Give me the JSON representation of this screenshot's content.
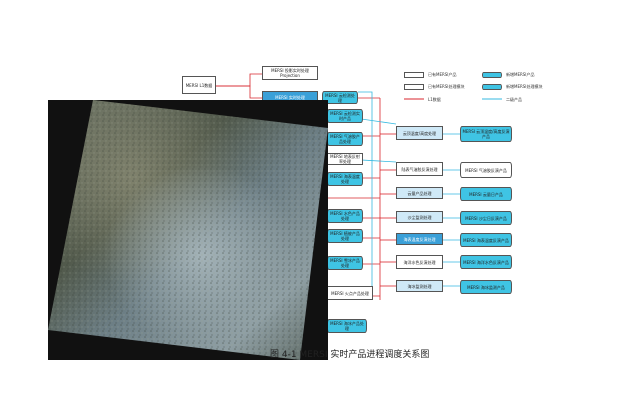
{
  "diagram": {
    "input": "MERSI L1数据",
    "top_box": "MERSI 投影实时处理 Projection",
    "left_column": [
      "MERSI 实时处理 ",
      "MERSI 云检测处理",
      "MERSI 云检测实时产品",
      "MERSI 气溶胶产品处理",
      "MERSI 地表反射率处理",
      "MERSI 海表温度处理",
      "MERSI 水色产品处理",
      "MERSI 植被产品处理",
      "MERSI 雪冰产品处理",
      "MERSI 火点产品处理",
      "MERSI 海冰产品处理"
    ],
    "middle_column": [
      "云顶温度/高度处理",
      "陆表气溶胶反演处理",
      "云量产品处理",
      "沙尘监测处理",
      "海表温度反演处理",
      "海洋水色反演处理",
      "海冰监测处理"
    ],
    "right_column": [
      "MERSI 云顶温度/高度反演产品",
      "MERSI 气溶胶反演产品",
      "MERSI 云量日产品",
      "MERSI 沙尘日反演产品",
      "MERSI 海表温度反演产品",
      "MERSI 海洋水色反演产品",
      "MERSI 海冰监测产品"
    ],
    "legend": [
      {
        "label": "已有MERSI产品",
        "kind": "box"
      },
      {
        "label": "新增MERSI产品",
        "kind": "cyl"
      },
      {
        "label": "已有MERSI处理模块",
        "kind": "box"
      },
      {
        "label": "新增MERSI处理模块",
        "kind": "cyl"
      },
      {
        "label": "L1数据",
        "kind": "arrow-red"
      },
      {
        "label": "二级产品",
        "kind": "arrow-cyan"
      }
    ]
  },
  "caption": "图 4-1 MERSI 实时产品进程调度关系图",
  "colors": {
    "red_arrow": "#d8262c",
    "cyan_arrow": "#35b9e0",
    "module_blue": "#3aa0d8"
  }
}
